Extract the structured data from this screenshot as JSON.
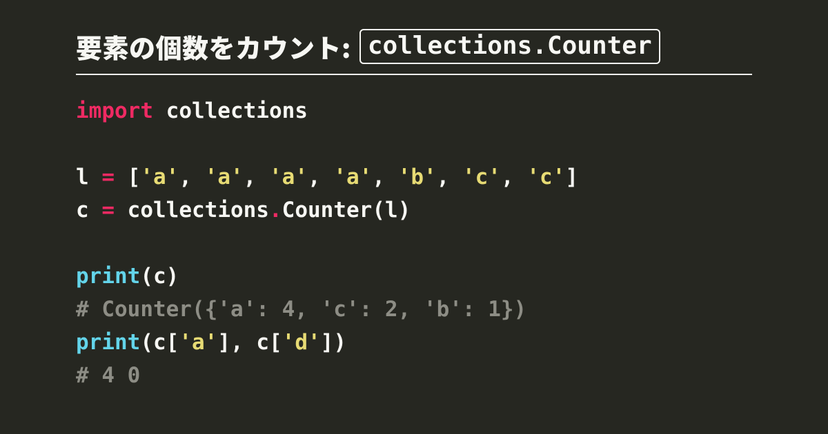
{
  "title": {
    "prefix": "要素の個数をカウント: ",
    "code": "collections.Counter"
  },
  "code": {
    "line1": {
      "kw": "import",
      "sp": " ",
      "mod": "collections"
    },
    "line3": {
      "v": "l ",
      "eq": "=",
      "sp": " ",
      "br_o": "[",
      "s1": "'a'",
      "c1": ", ",
      "s2": "'a'",
      "c2": ", ",
      "s3": "'a'",
      "c3": ", ",
      "s4": "'a'",
      "c4": ", ",
      "s5": "'b'",
      "c5": ", ",
      "s6": "'c'",
      "c6": ", ",
      "s7": "'c'",
      "br_c": "]"
    },
    "line4": {
      "v": "c ",
      "eq": "=",
      "sp": " ",
      "mod": "collections",
      "dot": ".",
      "cls": "Counter",
      "args": "(l)"
    },
    "line6": {
      "fn": "print",
      "args": "(c)"
    },
    "line7": {
      "comment": "# Counter({'a': 4, 'c': 2, 'b': 1})"
    },
    "line8": {
      "fn": "print",
      "po": "(",
      "v1": "c[",
      "s1": "'a'",
      "v1c": "], ",
      "v2": "c[",
      "s2": "'d'",
      "v2c": "]",
      "pc": ")"
    },
    "line9": {
      "comment": "# 4 0"
    }
  }
}
